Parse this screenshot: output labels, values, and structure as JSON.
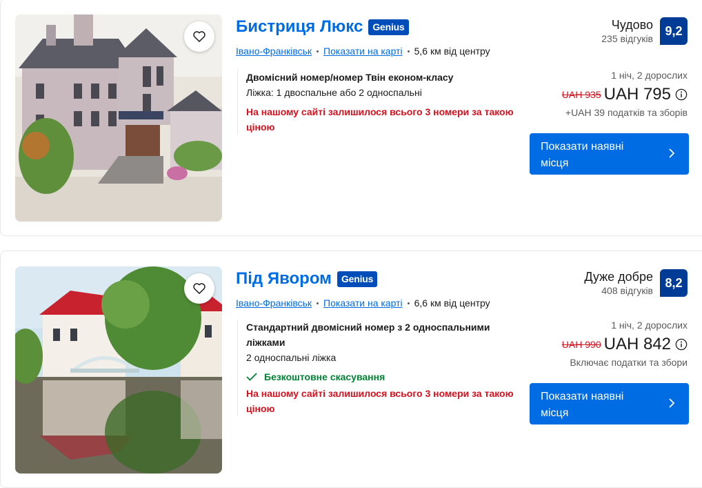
{
  "results": [
    {
      "name": "Бистриця Люкс",
      "genius_label": "Genius",
      "city_link": "Івано-Франківськ",
      "map_link": "Показати на карті",
      "distance": "5,6 км від центру",
      "room_name": "Двомісний номер/номер Твін економ-класу",
      "beds": "Ліжка: 1 двоспальне або 2 односпальні",
      "free_cancellation": "",
      "scarcity": "На нашому сайті залишилося всього 3 номери за такою ціною",
      "score_word": "Чудово",
      "reviews": "235 відгуків",
      "score": "9,2",
      "stay": "1 ніч, 2 дорослих",
      "old_price": "UAH 935",
      "price": "UAH 795",
      "taxes": "+UAH 39 податків та зборів",
      "cta_label": "Показати наявні місця",
      "photo_icon": "hotel-building-photo"
    },
    {
      "name": "Під Явором",
      "genius_label": "Genius",
      "city_link": "Івано-Франківськ",
      "map_link": "Показати на карті",
      "distance": "6,6 км від центру",
      "room_name": "Стандартний двомісний номер з 2 односпальними ліжками",
      "beds": "2 односпальні ліжка",
      "free_cancellation": "Безкоштовне скасування",
      "scarcity": "На нашому сайті залишилося всього 3 номери за такою ціною",
      "score_word": "Дуже добре",
      "reviews": "408 відгуків",
      "score": "8,2",
      "stay": "1 ніч, 2 дорослих",
      "old_price": "UAH 990",
      "price": "UAH 842",
      "taxes": "Включає податки та збори",
      "cta_label": "Показати наявні місця",
      "photo_icon": "hotel-pond-photo"
    }
  ],
  "colors": {
    "link": "#006ce4",
    "genius": "#004cb8",
    "score_badge": "#003b95",
    "scarcity": "#d4111e",
    "free_cancel": "#008234",
    "cta": "#006ce4"
  }
}
